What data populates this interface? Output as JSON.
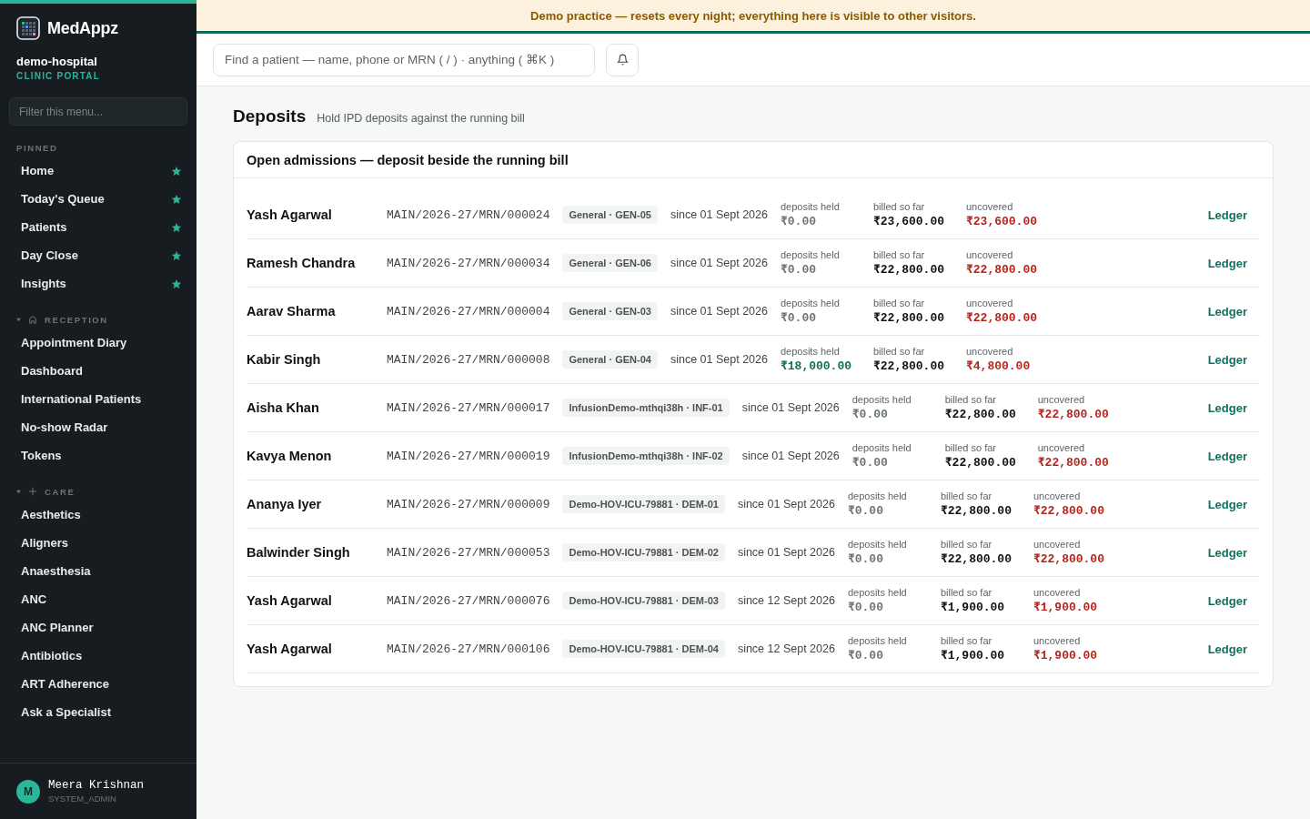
{
  "brand": {
    "name": "MedAppz",
    "org": "demo-hospital",
    "portal": "CLINIC PORTAL"
  },
  "sidebar": {
    "filter_placeholder": "Filter this menu...",
    "sections": [
      {
        "kind": "pinned",
        "title": "PINNED",
        "items": [
          {
            "label": "Home",
            "pinned": true
          },
          {
            "label": "Today's Queue",
            "pinned": true
          },
          {
            "label": "Patients",
            "pinned": true
          },
          {
            "label": "Day Close",
            "pinned": true
          },
          {
            "label": "Insights",
            "pinned": true
          }
        ]
      },
      {
        "kind": "reception",
        "title": "RECEPTION",
        "expanded": true,
        "items": [
          {
            "label": "Appointment Diary",
            "pinned": false
          },
          {
            "label": "Dashboard",
            "pinned": false
          },
          {
            "label": "International Patients",
            "pinned": false
          },
          {
            "label": "No-show Radar",
            "pinned": false
          },
          {
            "label": "Tokens",
            "pinned": false
          }
        ]
      },
      {
        "kind": "care",
        "title": "CARE",
        "expanded": true,
        "items": [
          {
            "label": "Aesthetics",
            "pinned": false
          },
          {
            "label": "Aligners",
            "pinned": false
          },
          {
            "label": "Anaesthesia",
            "pinned": false
          },
          {
            "label": "ANC",
            "pinned": false
          },
          {
            "label": "ANC Planner",
            "pinned": false
          },
          {
            "label": "Antibiotics",
            "pinned": false
          },
          {
            "label": "ART Adherence",
            "pinned": false
          },
          {
            "label": "Ask a Specialist",
            "pinned": false
          }
        ]
      }
    ]
  },
  "user": {
    "initial": "M",
    "name": "Meera Krishnan",
    "role": "SYSTEM_ADMIN"
  },
  "banner": "Demo practice — resets every night; everything here is visible to other visitors.",
  "search": {
    "placeholder": "Find a patient — name, phone or MRN ( / ) · anything ( ⌘K )"
  },
  "page": {
    "title": "Deposits",
    "subtitle": "Hold IPD deposits against the running bill"
  },
  "card": {
    "title": "Open admissions — deposit beside the running bill",
    "rows": [
      {
        "name": "Yash Agarwal",
        "mrn": "MAIN/2026-27/MRN/000024",
        "bed": "General · GEN-05",
        "since": "since 01 Sept 2026",
        "held_label": "deposits held",
        "held": "₹0.00",
        "has_deposit": false,
        "billed_label": "billed so far",
        "billed": "₹23,600.00",
        "uncovered_label": "uncovered",
        "uncovered": "₹23,600.00",
        "action": "Ledger"
      },
      {
        "name": "Ramesh Chandra",
        "mrn": "MAIN/2026-27/MRN/000034",
        "bed": "General · GEN-06",
        "since": "since 01 Sept 2026",
        "held_label": "deposits held",
        "held": "₹0.00",
        "has_deposit": false,
        "billed_label": "billed so far",
        "billed": "₹22,800.00",
        "uncovered_label": "uncovered",
        "uncovered": "₹22,800.00",
        "action": "Ledger"
      },
      {
        "name": "Aarav Sharma",
        "mrn": "MAIN/2026-27/MRN/000004",
        "bed": "General · GEN-03",
        "since": "since 01 Sept 2026",
        "held_label": "deposits held",
        "held": "₹0.00",
        "has_deposit": false,
        "billed_label": "billed so far",
        "billed": "₹22,800.00",
        "uncovered_label": "uncovered",
        "uncovered": "₹22,800.00",
        "action": "Ledger"
      },
      {
        "name": "Kabir Singh",
        "mrn": "MAIN/2026-27/MRN/000008",
        "bed": "General · GEN-04",
        "since": "since 01 Sept 2026",
        "held_label": "deposits held",
        "held": "₹18,000.00",
        "has_deposit": true,
        "billed_label": "billed so far",
        "billed": "₹22,800.00",
        "uncovered_label": "uncovered",
        "uncovered": "₹4,800.00",
        "action": "Ledger"
      },
      {
        "name": "Aisha Khan",
        "mrn": "MAIN/2026-27/MRN/000017",
        "bed": "InfusionDemo-mthqi38h · INF-01",
        "since": "since 01 Sept 2026",
        "held_label": "deposits held",
        "held": "₹0.00",
        "has_deposit": false,
        "billed_label": "billed so far",
        "billed": "₹22,800.00",
        "uncovered_label": "uncovered",
        "uncovered": "₹22,800.00",
        "action": "Ledger"
      },
      {
        "name": "Kavya Menon",
        "mrn": "MAIN/2026-27/MRN/000019",
        "bed": "InfusionDemo-mthqi38h · INF-02",
        "since": "since 01 Sept 2026",
        "held_label": "deposits held",
        "held": "₹0.00",
        "has_deposit": false,
        "billed_label": "billed so far",
        "billed": "₹22,800.00",
        "uncovered_label": "uncovered",
        "uncovered": "₹22,800.00",
        "action": "Ledger"
      },
      {
        "name": "Ananya Iyer",
        "mrn": "MAIN/2026-27/MRN/000009",
        "bed": "Demo-HOV-ICU-79881 · DEM-01",
        "since": "since 01 Sept 2026",
        "held_label": "deposits held",
        "held": "₹0.00",
        "has_deposit": false,
        "billed_label": "billed so far",
        "billed": "₹22,800.00",
        "uncovered_label": "uncovered",
        "uncovered": "₹22,800.00",
        "action": "Ledger"
      },
      {
        "name": "Balwinder Singh",
        "mrn": "MAIN/2026-27/MRN/000053",
        "bed": "Demo-HOV-ICU-79881 · DEM-02",
        "since": "since 01 Sept 2026",
        "held_label": "deposits held",
        "held": "₹0.00",
        "has_deposit": false,
        "billed_label": "billed so far",
        "billed": "₹22,800.00",
        "uncovered_label": "uncovered",
        "uncovered": "₹22,800.00",
        "action": "Ledger"
      },
      {
        "name": "Yash Agarwal",
        "mrn": "MAIN/2026-27/MRN/000076",
        "bed": "Demo-HOV-ICU-79881 · DEM-03",
        "since": "since 12 Sept 2026",
        "held_label": "deposits held",
        "held": "₹0.00",
        "has_deposit": false,
        "billed_label": "billed so far",
        "billed": "₹1,900.00",
        "uncovered_label": "uncovered",
        "uncovered": "₹1,900.00",
        "action": "Ledger"
      },
      {
        "name": "Yash Agarwal",
        "mrn": "MAIN/2026-27/MRN/000106",
        "bed": "Demo-HOV-ICU-79881 · DEM-04",
        "since": "since 12 Sept 2026",
        "held_label": "deposits held",
        "held": "₹0.00",
        "has_deposit": false,
        "billed_label": "billed so far",
        "billed": "₹1,900.00",
        "uncovered_label": "uncovered",
        "uncovered": "₹1,900.00",
        "action": "Ledger"
      }
    ]
  }
}
